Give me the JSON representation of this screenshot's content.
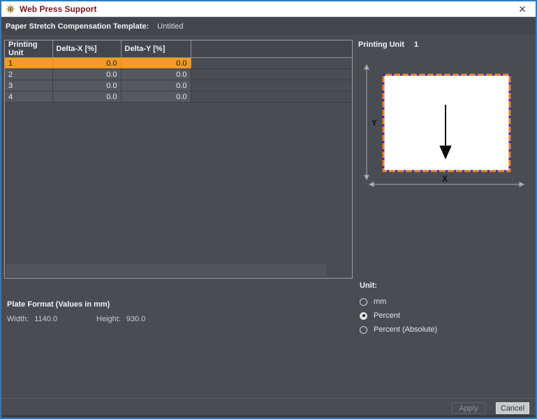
{
  "window": {
    "title": "Web Press Support",
    "close_glyph": "✕"
  },
  "template_bar": {
    "label": "Paper Stretch Compensation Template:",
    "value": "Untitled"
  },
  "table": {
    "columns": [
      "Printing Unit",
      "Delta-X [%]",
      "Delta-Y [%]"
    ],
    "rows": [
      {
        "unit": "1",
        "delta_x": "0.0",
        "delta_y": "0.0",
        "selected": true
      },
      {
        "unit": "2",
        "delta_x": "0.0",
        "delta_y": "0.0",
        "selected": false
      },
      {
        "unit": "3",
        "delta_x": "0.0",
        "delta_y": "0.0",
        "selected": false
      },
      {
        "unit": "4",
        "delta_x": "0.0",
        "delta_y": "0.0",
        "selected": false
      }
    ]
  },
  "diagram": {
    "heading_label": "Printing Unit",
    "heading_value": "1",
    "x_axis_label": "X",
    "y_axis_label": "Y"
  },
  "plate_format": {
    "title": "Plate Format (Values in mm)",
    "width_label": "Width:",
    "width_value": "1140.0",
    "height_label": "Height:",
    "height_value": "930.0"
  },
  "unit": {
    "label": "Unit:",
    "options": [
      {
        "label": "mm",
        "selected": false
      },
      {
        "label": "Percent",
        "selected": true
      },
      {
        "label": "Percent (Absolute)",
        "selected": false
      }
    ]
  },
  "buttons": {
    "apply": "Apply",
    "cancel": "Cancel"
  },
  "colors": {
    "selected_row": "#f79a1f",
    "window_border": "#2a7cc2",
    "rect_border_orange": "#e87e2b",
    "rect_border_blue": "#2b2bc8",
    "axis_gray": "#acacac"
  }
}
